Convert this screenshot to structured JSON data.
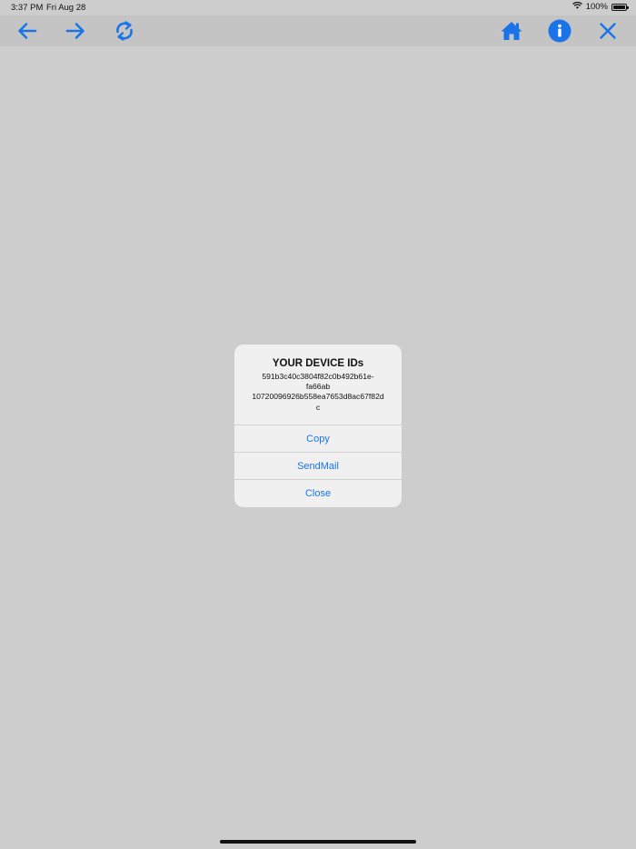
{
  "status_bar": {
    "time": "3:37 PM",
    "date": "Fri Aug 28",
    "battery": "100%"
  },
  "toolbar": {
    "back_icon": "arrow-left-icon",
    "forward_icon": "arrow-right-icon",
    "refresh_icon": "refresh-icon",
    "home_icon": "home-icon",
    "info_icon": "info-icon",
    "close_icon": "close-icon",
    "accent_color": "#1a74e8"
  },
  "alert": {
    "title": "YOUR DEVICE IDs",
    "message": "591b3c40c3804f82c0b492b61e-\nfa66ab\n10720096926b558ea7653d8ac67f82d\nc",
    "buttons": [
      {
        "label": "Copy"
      },
      {
        "label": "SendMail"
      },
      {
        "label": "Close"
      }
    ]
  }
}
